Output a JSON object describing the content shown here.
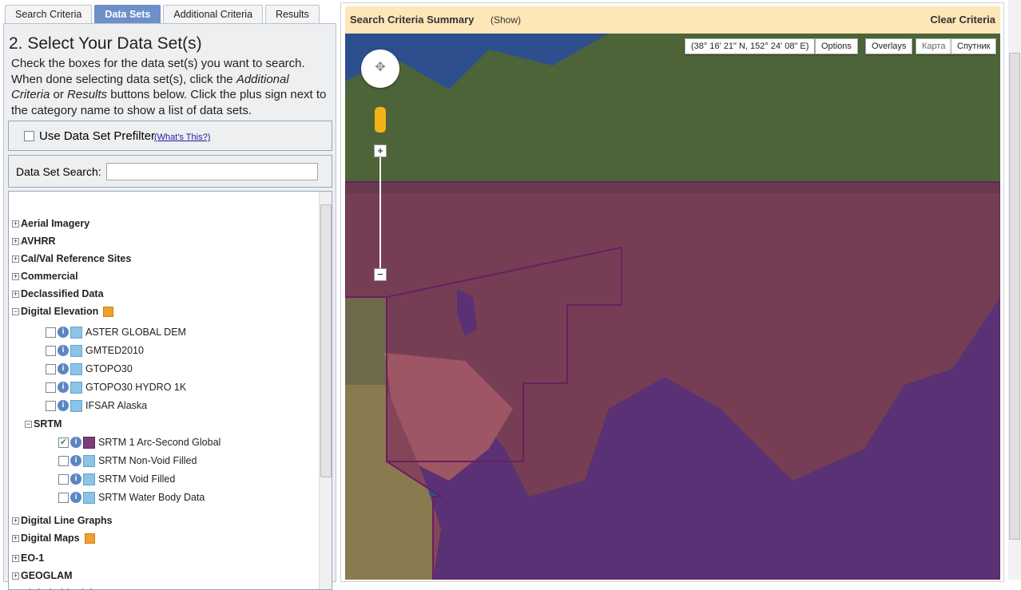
{
  "tabs": [
    "Search Criteria",
    "Data Sets",
    "Additional Criteria",
    "Results"
  ],
  "active_tab": "Data Sets",
  "title": "2. Select Your Data Set(s)",
  "intro": {
    "p1": "Check the boxes for the data set(s) you want to search. When done selecting data set(s), click the ",
    "em1": "Additional Criteria",
    "p2": " or ",
    "em2": "Results",
    "p3": " buttons below. Click the plus sign next to the category name to show a list of data sets."
  },
  "prefilter": {
    "label": "Use Data Set Prefilter",
    "link": "(What's This?)",
    "checked": false
  },
  "search": {
    "label": "Data Set Search:",
    "value": ""
  },
  "tree": {
    "categories_top": [
      "Aerial Imagery",
      "AVHRR",
      "Cal/Val Reference Sites",
      "Commercial",
      "Declassified Data"
    ],
    "expanded": "Digital Elevation",
    "children": [
      "ASTER GLOBAL DEM",
      "GMTED2010",
      "GTOPO30",
      "GTOPO30 HYDRO 1K",
      "IFSAR Alaska"
    ],
    "sub": "SRTM",
    "sub_children": [
      {
        "label": "SRTM 1 Arc-Second Global",
        "checked": true
      },
      {
        "label": "SRTM Non-Void Filled",
        "checked": false
      },
      {
        "label": "SRTM Void Filled",
        "checked": false
      },
      {
        "label": "SRTM Water Body Data",
        "checked": false
      }
    ],
    "categories_bottom": [
      {
        "label": "Digital Line Graphs",
        "badge": false
      },
      {
        "label": "Digital Maps",
        "badge": true
      },
      {
        "label": "EO-1",
        "badge": false
      },
      {
        "label": "GEOGLAM",
        "badge": false
      },
      {
        "label": "Global Fiducials",
        "badge": false
      }
    ]
  },
  "summary": {
    "title": "Search Criteria Summary",
    "show": "(Show)",
    "clear": "Clear Criteria"
  },
  "map": {
    "coords": "(38° 16' 21\" N, 152° 24' 08\" E)",
    "options": "Options",
    "overlays": "Overlays",
    "map_type": "Карта",
    "satellite": "Спутник",
    "zoom_in": "+",
    "zoom_out": "−"
  },
  "colors": {
    "tab_active": "#6e8fc9",
    "summary_bg": "#fde6b8",
    "footprint": "#7a3f78"
  }
}
